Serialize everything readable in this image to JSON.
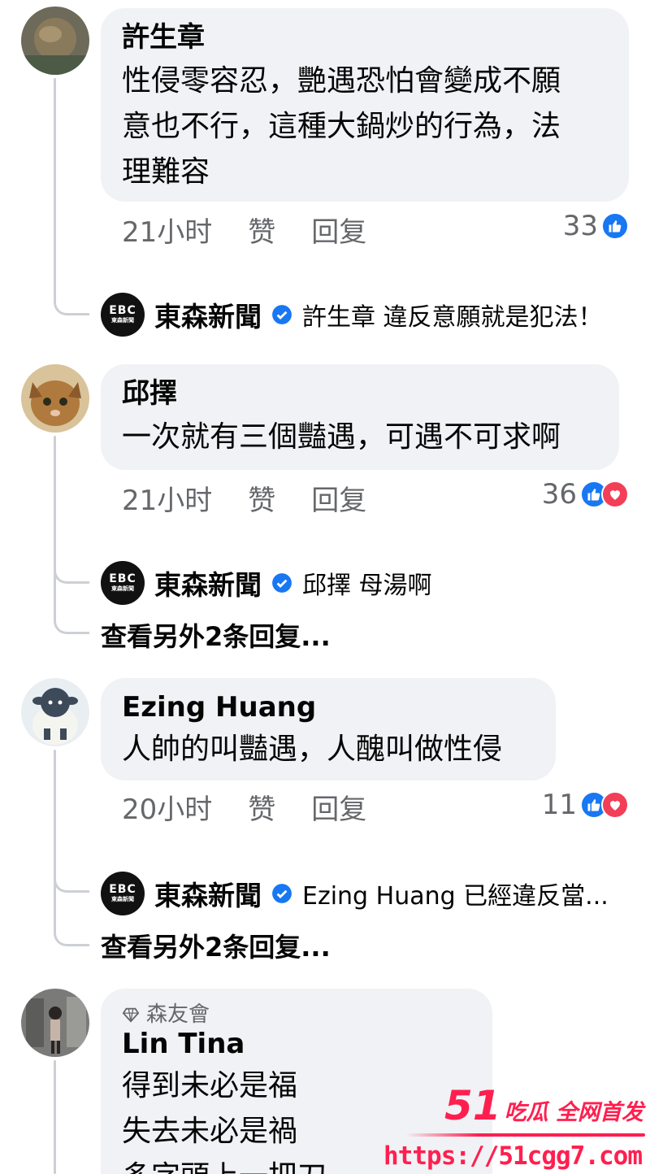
{
  "comments": [
    {
      "author": "許生章",
      "text_lines": [
        "性侵零容忍，艷遇恐怕會變成不願",
        "意也不行，這種大鍋炒的行為，法",
        "理難容"
      ],
      "time": "21小时",
      "like_label": "赞",
      "reply_label": "回复",
      "reaction_count": "33",
      "reply": {
        "page": "東森新聞",
        "text": "許生章 違反意願就是犯法！"
      }
    },
    {
      "author": "邱擇",
      "text_lines": [
        "一次就有三個豔遇，可遇不可求啊"
      ],
      "time": "21小时",
      "like_label": "赞",
      "reply_label": "回复",
      "reaction_count": "36",
      "reply": {
        "page": "東森新聞",
        "text": "邱擇 母湯啊"
      },
      "more_replies": "查看另外2条回复..."
    },
    {
      "author": "Ezing Huang",
      "text_lines": [
        "人帥的叫豔遇，人醜叫做性侵"
      ],
      "time": "20小时",
      "like_label": "赞",
      "reply_label": "回复",
      "reaction_count": "11",
      "reply": {
        "page": "東森新聞",
        "text": "Ezing Huang 已經違反當..."
      },
      "more_replies": "查看另外2条回复..."
    },
    {
      "badge": "森友會",
      "author": "Lin Tina",
      "text_lines": [
        "得到未必是福",
        "失去未必是禍",
        "多字頭上一把刀"
      ]
    }
  ],
  "page_avatar": {
    "logo": "EBC",
    "sub": "東森新聞"
  },
  "watermark": {
    "number": "51",
    "brand": "吃瓜 全网首发",
    "url": "https://51cgg7.com"
  },
  "colors": {
    "like_blue": "#1877f2",
    "love_red": "#f33e58",
    "watermark": "#ff1f4f"
  }
}
